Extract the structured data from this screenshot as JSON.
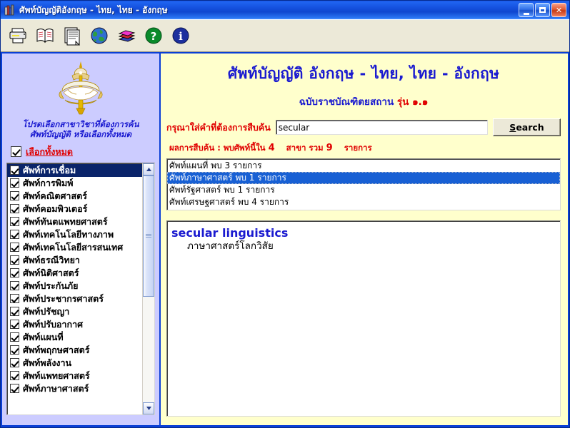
{
  "window": {
    "title": "ศัพท์บัญญัติอังกฤษ - ไทย, ไทย - อังกฤษ",
    "icon": "books-icon",
    "minimize_label": "Minimize",
    "maximize_label": "Maximize",
    "close_label": "Close"
  },
  "toolbar": {
    "buttons": [
      {
        "name": "print-icon",
        "label": "Print"
      },
      {
        "name": "open-book-icon",
        "label": "Dictionary"
      },
      {
        "name": "document-icon",
        "label": "Document"
      },
      {
        "name": "globe-icon",
        "label": "Web"
      },
      {
        "name": "book-stack-icon",
        "label": "Books"
      },
      {
        "name": "help-question-icon",
        "label": "Help"
      },
      {
        "name": "info-icon",
        "label": "About"
      }
    ]
  },
  "sidebar": {
    "emblem_alt": "royal-institute-emblem",
    "instruction_line1": "โปรดเลือกสาขาวิชาที่ต้องการค้น",
    "instruction_line2": "ศัพท์บัญญัติ หรือเลือกทั้งหมด",
    "select_all_label": "เลือกทั้งหมด",
    "select_all_checked": true,
    "items": [
      {
        "label": "ศัพท์การเชื่อม",
        "checked": true,
        "selected": true
      },
      {
        "label": "ศัพท์การพิมพ์",
        "checked": true,
        "selected": false
      },
      {
        "label": "ศัพท์คณิตศาสตร์",
        "checked": true,
        "selected": false
      },
      {
        "label": "ศัพท์คอมพิวเตอร์",
        "checked": true,
        "selected": false
      },
      {
        "label": "ศัพท์ทันตแพทยศาสตร์",
        "checked": true,
        "selected": false
      },
      {
        "label": "ศัพท์เทคโนโลยีทางภาพ",
        "checked": true,
        "selected": false
      },
      {
        "label": "ศัพท์เทคโนโลยีสารสนเทศ",
        "checked": true,
        "selected": false
      },
      {
        "label": "ศัพท์ธรณีวิทยา",
        "checked": true,
        "selected": false
      },
      {
        "label": "ศัพท์นิติศาสตร์",
        "checked": true,
        "selected": false
      },
      {
        "label": "ศัพท์ประกันภัย",
        "checked": true,
        "selected": false
      },
      {
        "label": "ศัพท์ประชากรศาสตร์",
        "checked": true,
        "selected": false
      },
      {
        "label": "ศัพท์ปรัชญา",
        "checked": true,
        "selected": false
      },
      {
        "label": "ศัพท์ปรับอากาศ",
        "checked": true,
        "selected": false
      },
      {
        "label": "ศัพท์แผนที่",
        "checked": true,
        "selected": false
      },
      {
        "label": "ศัพท์พฤกษศาสตร์",
        "checked": true,
        "selected": false
      },
      {
        "label": "ศัพท์พลังงาน",
        "checked": true,
        "selected": false
      },
      {
        "label": "ศัพท์แพทยศาสตร์",
        "checked": true,
        "selected": false
      },
      {
        "label": "ศัพท์ภาษาศาสตร์",
        "checked": true,
        "selected": false
      }
    ],
    "scrollbar": {
      "up_arrow": "▲",
      "down_arrow": "▼"
    }
  },
  "main": {
    "title": "ศัพท์บัญญัติ อังกฤษ - ไทย, ไทย - อังกฤษ",
    "subtitle_text": "ฉบับราชบัณฑิตยสถาน",
    "subtitle_version": "รุ่น ๑.๑",
    "search": {
      "label": "กรุณาใส่คำที่ต้องการสืบค้น",
      "value": "secular",
      "placeholder": "",
      "button_accel": "S",
      "button_rest": "earch"
    },
    "status": {
      "prefix": "ผลการสืบค้น : พบศัพท์นี้ใน",
      "count_subjects": "4",
      "middle": "สาขา รวม",
      "count_entries": "9",
      "suffix": "รายการ"
    },
    "categories": [
      {
        "label": "ศัพท์แผนที่ พบ 3 รายการ",
        "selected": false
      },
      {
        "label": "ศัพท์ภาษาศาสตร์ พบ 1 รายการ",
        "selected": true
      },
      {
        "label": "ศัพท์รัฐศาสตร์ พบ 1 รายการ",
        "selected": false
      },
      {
        "label": "ศัพท์เศรษฐศาสตร์ พบ 4 รายการ",
        "selected": false
      }
    ],
    "entries": [
      {
        "term": "secular linguistics",
        "meaning": "ภาษาศาสตร์โลกวิสัย"
      }
    ]
  },
  "colors": {
    "sidebar_bg": "#ccccff",
    "main_bg": "#ffffcc",
    "accent_blue": "#1a1ad0",
    "accent_red": "#e00000",
    "selection_blue": "#1860d4",
    "window_frame": "#0a3fd6"
  }
}
